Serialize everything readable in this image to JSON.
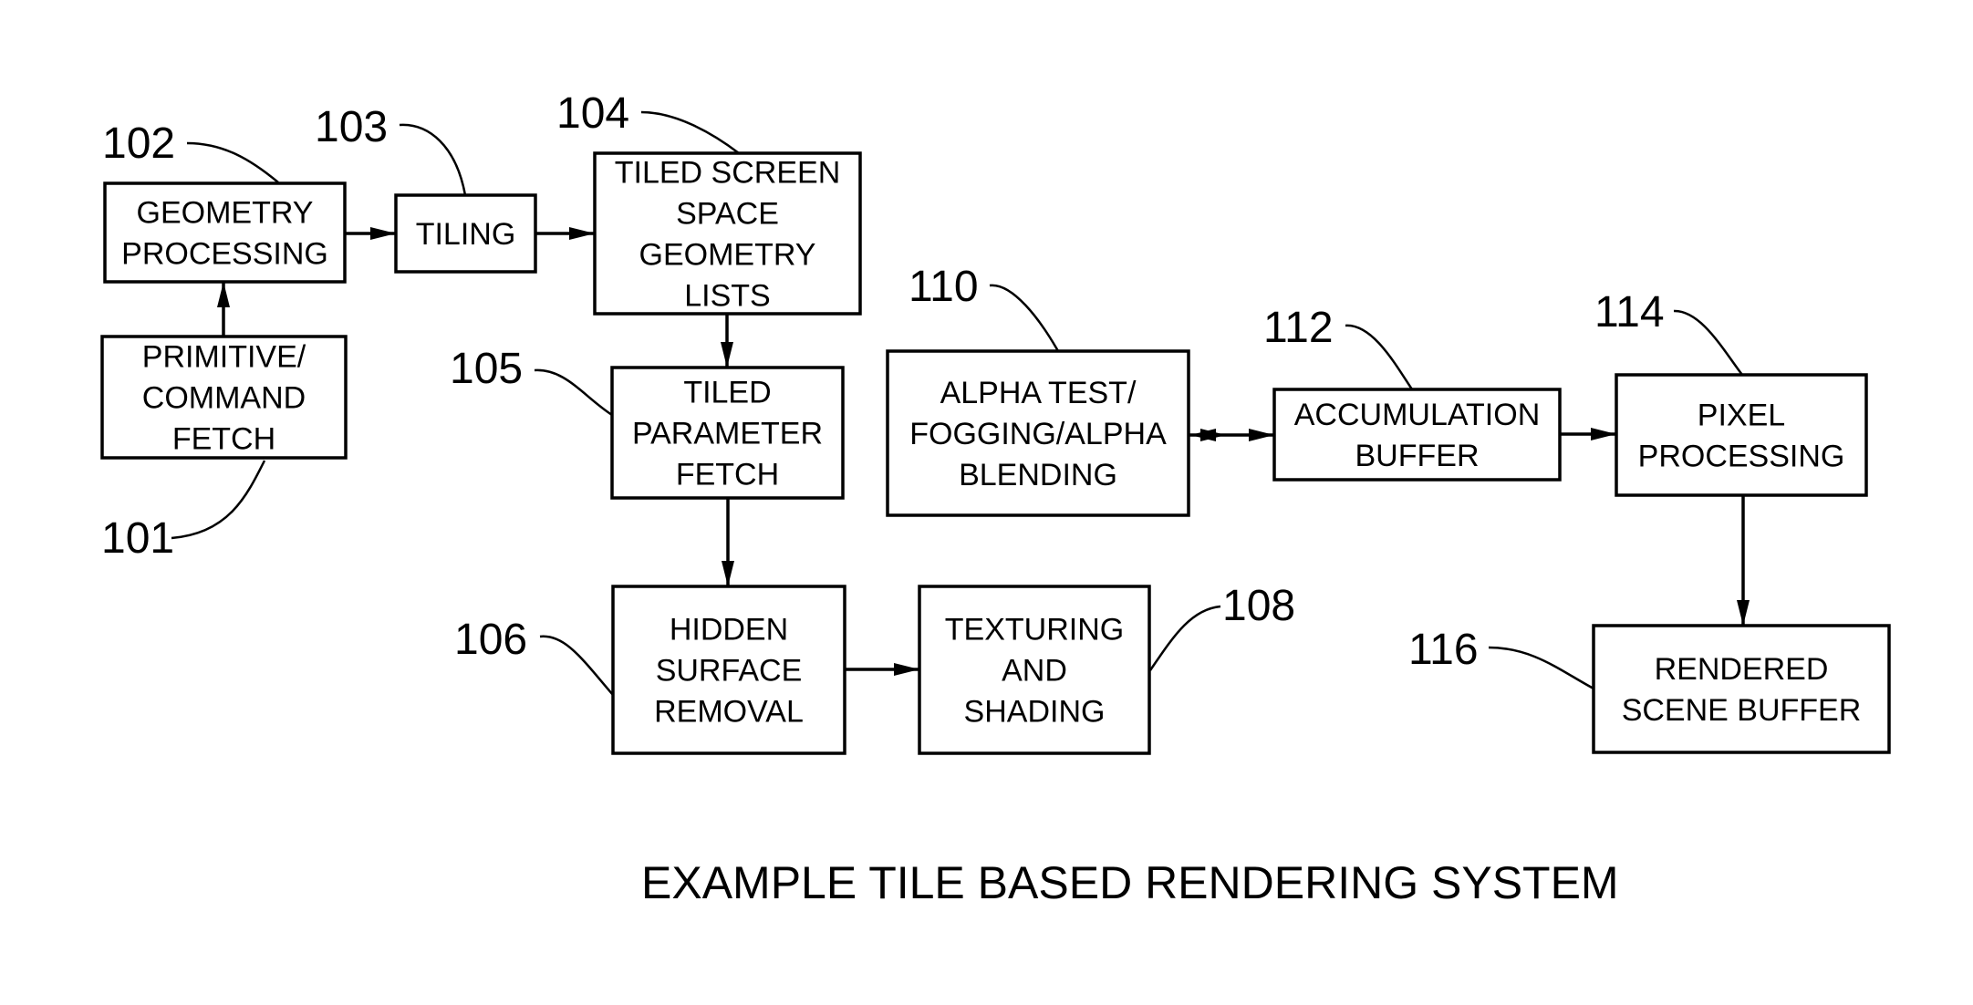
{
  "figure": {
    "caption": "EXAMPLE TILE BASED RENDERING SYSTEM",
    "blocks": [
      {
        "id": "101",
        "ref": "101",
        "lines": [
          "PRIMITIVE/",
          "COMMAND",
          "FETCH"
        ]
      },
      {
        "id": "102",
        "ref": "102",
        "lines": [
          "GEOMETRY",
          "PROCESSING"
        ]
      },
      {
        "id": "103",
        "ref": "103",
        "lines": [
          "TILING"
        ]
      },
      {
        "id": "104",
        "ref": "104",
        "lines": [
          "TILED SCREEN",
          "SPACE",
          "GEOMETRY",
          "LISTS"
        ]
      },
      {
        "id": "105",
        "ref": "105",
        "lines": [
          "TILED",
          "PARAMETER",
          "FETCH"
        ]
      },
      {
        "id": "106",
        "ref": "106",
        "lines": [
          "HIDDEN",
          "SURFACE",
          "REMOVAL"
        ]
      },
      {
        "id": "108",
        "ref": "108",
        "lines": [
          "TEXTURING",
          "AND",
          "SHADING"
        ]
      },
      {
        "id": "110",
        "ref": "110",
        "lines": [
          "ALPHA TEST/",
          "FOGGING/ALPHA",
          "BLENDING"
        ]
      },
      {
        "id": "112",
        "ref": "112",
        "lines": [
          "ACCUMULATION",
          "BUFFER"
        ]
      },
      {
        "id": "114",
        "ref": "114",
        "lines": [
          "PIXEL",
          "PROCESSING"
        ]
      },
      {
        "id": "116",
        "ref": "116",
        "lines": [
          "RENDERED",
          "SCENE BUFFER"
        ]
      }
    ],
    "connections": [
      {
        "from": "101",
        "to": "102",
        "type": "arrow"
      },
      {
        "from": "102",
        "to": "103",
        "type": "arrow"
      },
      {
        "from": "103",
        "to": "104",
        "type": "arrow"
      },
      {
        "from": "104",
        "to": "105",
        "type": "arrow"
      },
      {
        "from": "105",
        "to": "106",
        "type": "arrow"
      },
      {
        "from": "106",
        "to": "108",
        "type": "arrow"
      },
      {
        "from": "110",
        "to": "112",
        "type": "bidirectional"
      },
      {
        "from": "112",
        "to": "114",
        "type": "arrow"
      },
      {
        "from": "114",
        "to": "116",
        "type": "arrow"
      }
    ]
  }
}
